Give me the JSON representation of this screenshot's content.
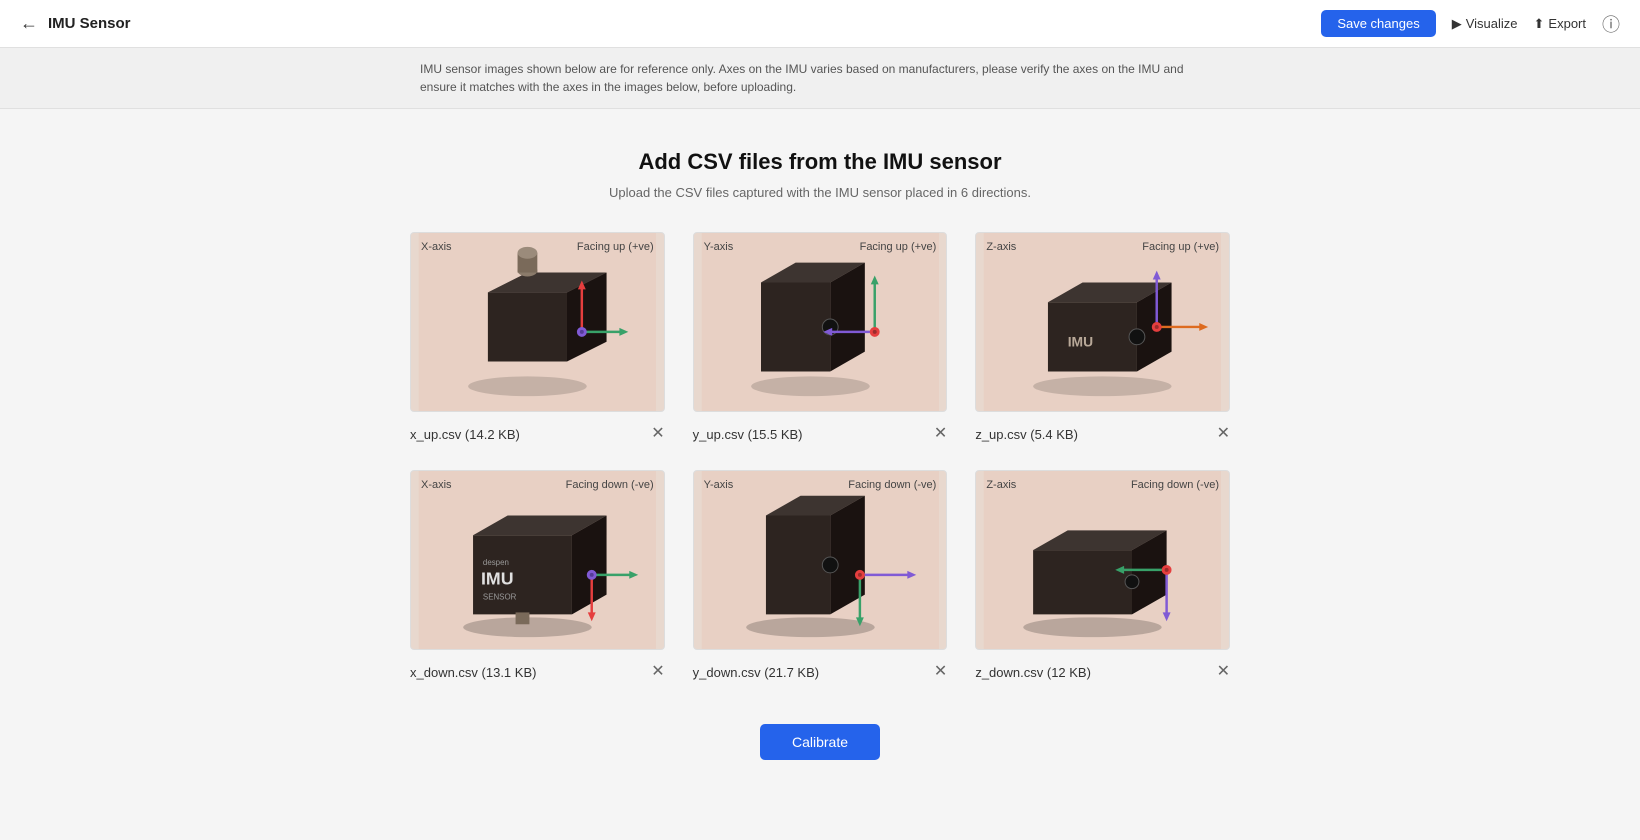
{
  "header": {
    "back_label": "←",
    "title": "IMU Sensor",
    "save_label": "Save changes",
    "visualize_label": "Visualize",
    "export_label": "Export",
    "help_label": "?"
  },
  "notice": {
    "text": "IMU sensor images shown below are for reference only. Axes on the IMU varies based on manufacturers, please verify the axes on the IMU and ensure it matches with the axes in the images below, before uploading."
  },
  "page": {
    "heading": "Add CSV files from the IMU sensor",
    "subheading": "Upload the CSV files captured with the IMU sensor placed in 6 directions."
  },
  "sensors": [
    {
      "axis": "X-axis",
      "direction": "Facing up (+ve)",
      "orientation": "x_up",
      "file": "x_up.csv",
      "size": "14.2 KB"
    },
    {
      "axis": "Y-axis",
      "direction": "Facing up (+ve)",
      "orientation": "y_up",
      "file": "y_up.csv",
      "size": "15.5 KB"
    },
    {
      "axis": "Z-axis",
      "direction": "Facing up (+ve)",
      "orientation": "z_up",
      "file": "z_up.csv",
      "size": "5.4 KB"
    },
    {
      "axis": "X-axis",
      "direction": "Facing down (-ve)",
      "orientation": "x_down",
      "file": "x_down.csv",
      "size": "13.1 KB"
    },
    {
      "axis": "Y-axis",
      "direction": "Facing down (-ve)",
      "orientation": "y_down",
      "file": "y_down.csv",
      "size": "21.7 KB"
    },
    {
      "axis": "Z-axis",
      "direction": "Facing down (-ve)",
      "orientation": "z_down",
      "file": "z_down.csv",
      "size": "12 KB"
    }
  ],
  "calibrate_label": "Calibrate"
}
